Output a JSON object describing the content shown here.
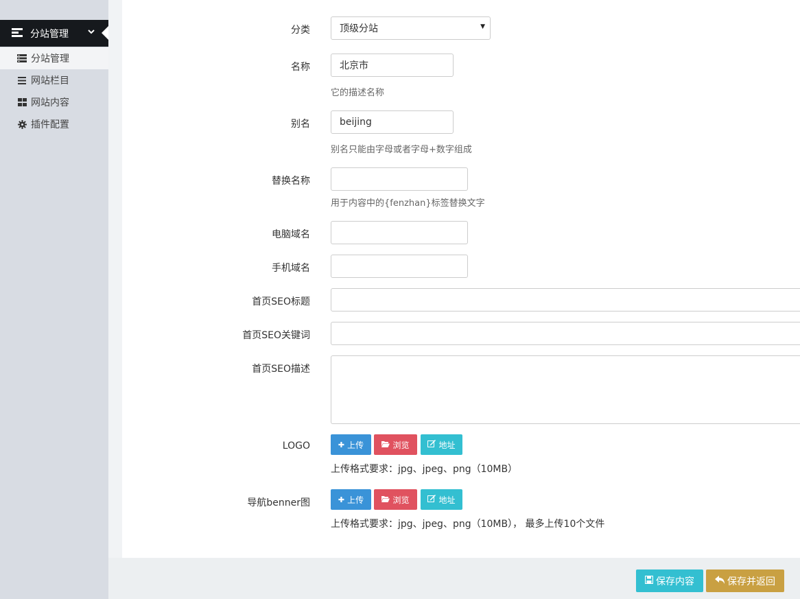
{
  "sidebar": {
    "header": {
      "label": "分站管理",
      "icon": "list-icon"
    },
    "items": [
      {
        "label": "分站管理",
        "icon": "server-icon",
        "active": true
      },
      {
        "label": "网站栏目",
        "icon": "bars-icon"
      },
      {
        "label": "网站内容",
        "icon": "grid-icon"
      },
      {
        "label": "插件配置",
        "icon": "gear-icon"
      }
    ]
  },
  "form": {
    "category": {
      "label": "分类",
      "value": "顶级分站"
    },
    "name": {
      "label": "名称",
      "value": "北京市",
      "help": "它的描述名称"
    },
    "alias": {
      "label": "别名",
      "value": "beijing",
      "help": "别名只能由字母或者字母+数字组成"
    },
    "replace_name": {
      "label": "替换名称",
      "value": "",
      "help": "用于内容中的{fenzhan}标签替换文字"
    },
    "pc_domain": {
      "label": "电脑域名",
      "value": ""
    },
    "mobile_domain": {
      "label": "手机域名",
      "value": ""
    },
    "seo_title": {
      "label": "首页SEO标题",
      "value": ""
    },
    "seo_keywords": {
      "label": "首页SEO关键词",
      "value": ""
    },
    "seo_description": {
      "label": "首页SEO描述",
      "value": ""
    },
    "logo": {
      "label": "LOGO",
      "help": "上传格式要求：jpg、jpeg、png（10MB）"
    },
    "banner": {
      "label": "导航benner图",
      "help": "上传格式要求：jpg、jpeg、png（10MB），  最多上传10个文件"
    },
    "upload_label": "上传",
    "browse_label": "浏览",
    "address_label": "地址"
  },
  "footer": {
    "save_label": "保存内容",
    "save_return_label": "保存并返回"
  },
  "colors": {
    "sidebar_bg": "#d8dce3",
    "sidebar_header_bg": "#16191d",
    "upload": "#3a93d8",
    "browse": "#e0525f",
    "address": "#33bfd1",
    "save": "#33bfd1",
    "save_return": "#c9a042"
  }
}
